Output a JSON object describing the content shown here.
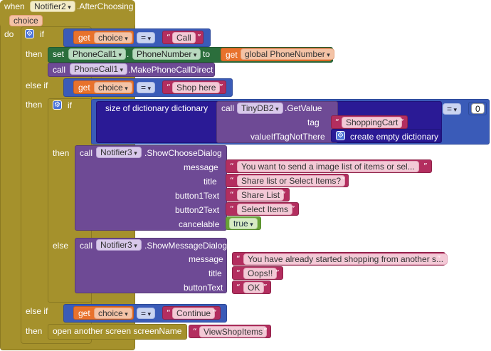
{
  "event": {
    "when": "when",
    "component": "Notifier2",
    "event_name": ".AfterChoosing",
    "param": "choice",
    "do": "do"
  },
  "if1": {
    "if": "if",
    "get": "get",
    "var": "choice",
    "op": "=",
    "value": "Call",
    "then": "then",
    "set": "set",
    "set_comp": "PhoneCall1",
    "dot": ".",
    "set_prop": "PhoneNumber",
    "to": "to",
    "get2": "get",
    "global_var": "global PhoneNumber",
    "call": "call",
    "call_comp": "PhoneCall1",
    "call_method": ".MakePhoneCallDirect"
  },
  "elseif1": {
    "label": "else if",
    "get": "get",
    "var": "choice",
    "op": "=",
    "value": "Shop here",
    "then": "then"
  },
  "inner_if": {
    "if": "if",
    "size_label": "size of dictionary  dictionary",
    "call": "call",
    "tinydb": "TinyDB2",
    "getvalue": ".GetValue",
    "tag_label": "tag",
    "tag_value": "ShoppingCart",
    "value_if_label": "valueIfTagNotThere",
    "empty_dict": "create empty dictionary",
    "op": "=",
    "num": "0"
  },
  "then2": {
    "label": "then",
    "call": "call",
    "notifier": "Notifier3",
    "method": ".ShowChooseDialog",
    "message_label": "message",
    "message": "You want to send a image list of items or sel...",
    "title_label": "title",
    "title": "Share list or Select Items?",
    "b1_label": "button1Text",
    "b1": "Share List",
    "b2_label": "button2Text",
    "b2": "Select Items",
    "cancel_label": "cancelable",
    "cancel": "true"
  },
  "else2": {
    "label": "else",
    "call": "call",
    "notifier": "Notifier3",
    "method": ".ShowMessageDialog",
    "message_label": "message",
    "message": "You have already started shopping from another s...",
    "title_label": "title",
    "title": "Oops!!",
    "btn_label": "buttonText",
    "btn": "OK"
  },
  "elseif2": {
    "label": "else if",
    "get": "get",
    "var": "choice",
    "op": "=",
    "value": "Continue",
    "then": "then",
    "open_label": "open another screen  screenName",
    "screen": "ViewShopItems"
  },
  "quote_open": "“",
  "quote_close": "”"
}
